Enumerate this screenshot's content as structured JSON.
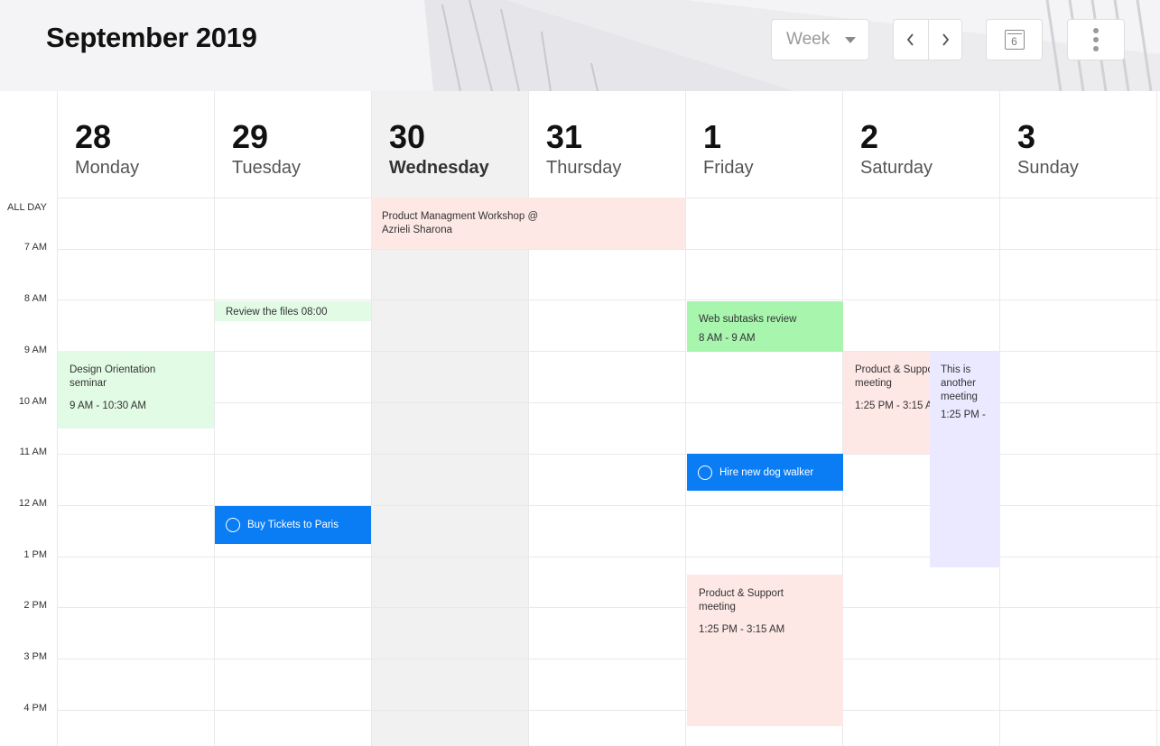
{
  "header": {
    "title": "September 2019",
    "view_label": "Week",
    "today_day": "6"
  },
  "days": [
    {
      "num": "28",
      "name": "Monday"
    },
    {
      "num": "29",
      "name": "Tuesday"
    },
    {
      "num": "30",
      "name": "Wednesday"
    },
    {
      "num": "31",
      "name": "Thursday"
    },
    {
      "num": "1",
      "name": "Friday"
    },
    {
      "num": "2",
      "name": "Saturday"
    },
    {
      "num": "3",
      "name": "Sunday"
    }
  ],
  "times": {
    "all_day": "ALL DAY",
    "labels": [
      "7 AM",
      "8 AM",
      "9 AM",
      "10 AM",
      "11 AM",
      "12 AM",
      "1 PM",
      "2 PM",
      "3 PM",
      "4 PM"
    ]
  },
  "events": {
    "workshop": {
      "title": "Product Managment Workshop @ Azrieli Sharona"
    },
    "review_files": {
      "title": "Review the files 08:00"
    },
    "design_orientation": {
      "title": "Design Orientation seminar",
      "time": "9 AM - 10:30 AM"
    },
    "buy_tickets": {
      "title": "Buy Tickets to Paris"
    },
    "web_subtasks": {
      "title": "Web subtasks review",
      "time": "8 AM - 9 AM"
    },
    "dog_walker": {
      "title": "Hire new dog walker"
    },
    "product_support_fri": {
      "title": "Product & Support meeting",
      "time": "1:25 PM - 3:15 AM"
    },
    "product_support_sat": {
      "title": "Product & Support meeting",
      "time": "1:25 PM - 3:15 AM"
    },
    "another_meeting": {
      "title": "This is another meeting",
      "time": "1:25 PM -"
    }
  },
  "colors": {
    "accent_blue": "#0a7df5",
    "event_pink": "#fde8e6",
    "event_green": "#a8f5ae",
    "event_green_light": "#e2fbe5",
    "event_lavender": "#ebe9ff",
    "today_column": "#f1f1f2"
  },
  "icons": {
    "view_dropdown": "chevron-down-icon",
    "prev": "chevron-left-icon",
    "next": "chevron-right-icon",
    "today": "calendar-icon",
    "more": "more-vertical-icon",
    "task": "circle-icon"
  }
}
